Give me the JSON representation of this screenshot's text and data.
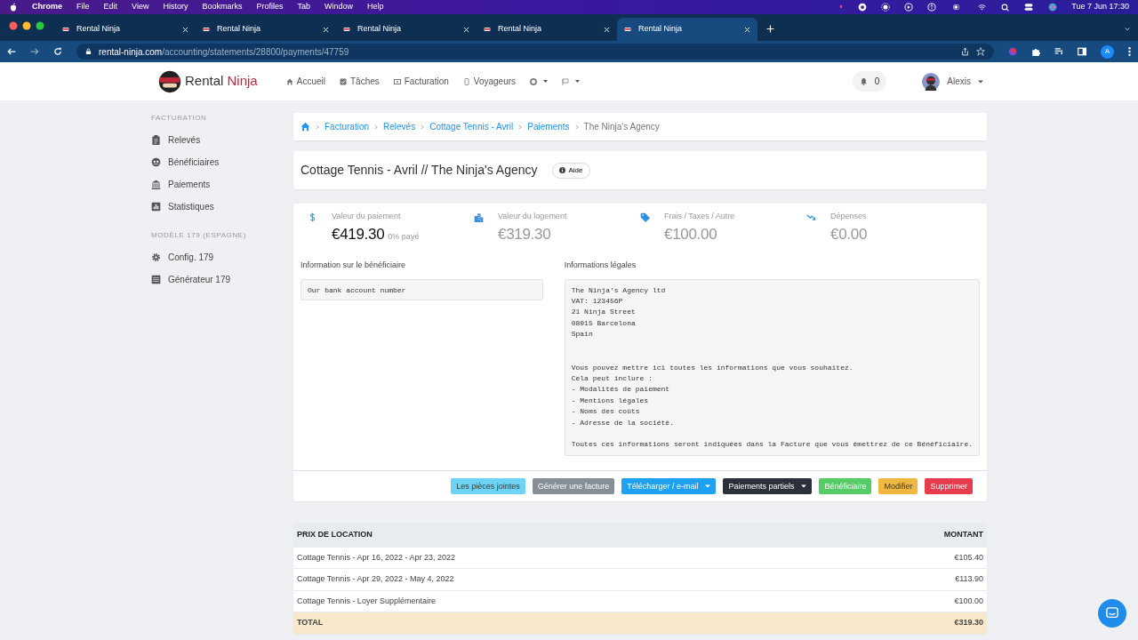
{
  "menubar": {
    "app": "Chrome",
    "items": [
      "File",
      "Edit",
      "View",
      "History",
      "Bookmarks",
      "Profiles",
      "Tab",
      "Window",
      "Help"
    ],
    "clock": "Tue 7 Jun  17:30"
  },
  "browser": {
    "tabs": [
      {
        "title": "Rental Ninja",
        "selected": false
      },
      {
        "title": "Rental Ninja",
        "selected": false
      },
      {
        "title": "Rental Ninja",
        "selected": false
      },
      {
        "title": "Rental Ninja",
        "selected": false
      },
      {
        "title": "Rental Ninja",
        "selected": true
      }
    ],
    "url": {
      "host": "rental-ninja.com",
      "path": "/accounting/statements/28800/payments/47759"
    },
    "profile": "A"
  },
  "navbar": {
    "brand": [
      "Rental",
      "Ninja"
    ],
    "links": [
      "Accueil",
      "Tâches",
      "Facturation",
      "Voyageurs"
    ],
    "notifications": "0",
    "user": "Alexis"
  },
  "sidebar": [
    {
      "heading": "FACTURATION",
      "items": [
        "Relevés",
        "Bénéficiaires",
        "Paiements",
        "Statistiques"
      ]
    },
    {
      "heading": "MODÈLE 179 (ESPAGNE)",
      "items": [
        "Config. 179",
        "Générateur 179"
      ]
    }
  ],
  "breadcrumb": {
    "links": [
      "Facturation",
      "Relevés",
      "Cottage Tennis - Avril",
      "Paiements"
    ],
    "current": "The Ninja's Agency"
  },
  "header": {
    "title": "Cottage Tennis - Avril // The Ninja's Agency",
    "help": "Aide"
  },
  "stats": [
    {
      "label": "Valeur du paiement",
      "value": "€419.30",
      "note": "0% payé",
      "highlighted": true
    },
    {
      "label": "Valeur du logement",
      "value": "€319.30",
      "highlighted": false
    },
    {
      "label": "Frais / Taxes / Autre",
      "value": "€100.00",
      "highlighted": false
    },
    {
      "label": "Dépenses",
      "value": "€0.00",
      "highlighted": false
    }
  ],
  "beneficiary_info": {
    "label": "Information sur le bénéficiaire",
    "value": "Our bank account number"
  },
  "legal_info": {
    "label": "Informations légales",
    "paragraphs": [
      [
        "The Ninja's Agency ltd",
        "VAT: 123456P",
        "21 Ninja Street",
        "08015 Barcelona",
        "Spain"
      ],
      [
        "Vous pouvez mettre ici toutes les informations que vous souhaitez.",
        "Cela peut inclure :",
        "- Modalités de paiement",
        "- Mentions légales",
        "- Noms des coûts",
        "- Adresse de la société."
      ],
      [
        "Toutes ces informations seront indiquées dans la Facture que vous émettrez de ce Bénéficiaire."
      ]
    ]
  },
  "actions": [
    {
      "label": "Les pièces jointes",
      "color": "#6dd3f7",
      "dropdown": false
    },
    {
      "label": "Générer une facture",
      "color": "#868e96",
      "dropdown": false
    },
    {
      "label": "Télécharger / e-mail",
      "color": "#1ea1f2",
      "dropdown": true
    },
    {
      "label": "Paiements partiels",
      "color": "#2b303a",
      "dropdown": true
    },
    {
      "label": "Bénéficiaire",
      "color": "#55cc66",
      "dropdown": false
    },
    {
      "label": "Modifier",
      "color": "#f0b840",
      "dropdown": false
    },
    {
      "label": "Supprimer",
      "color": "#e63c4e",
      "dropdown": false
    }
  ],
  "rent_table": {
    "columns": [
      "PRIX DE LOCATION",
      "MONTANT"
    ],
    "rows": [
      [
        "Cottage Tennis - Apr 16, 2022 - Apr 23, 2022",
        "€105.40"
      ],
      [
        "Cottage Tennis - Apr 29, 2022 - May 4, 2022",
        "€113.90"
      ],
      [
        "Cottage Tennis - Loyer Supplémentaire",
        "€100.00"
      ]
    ],
    "total": [
      "TOTAL",
      "€319.30"
    ]
  }
}
